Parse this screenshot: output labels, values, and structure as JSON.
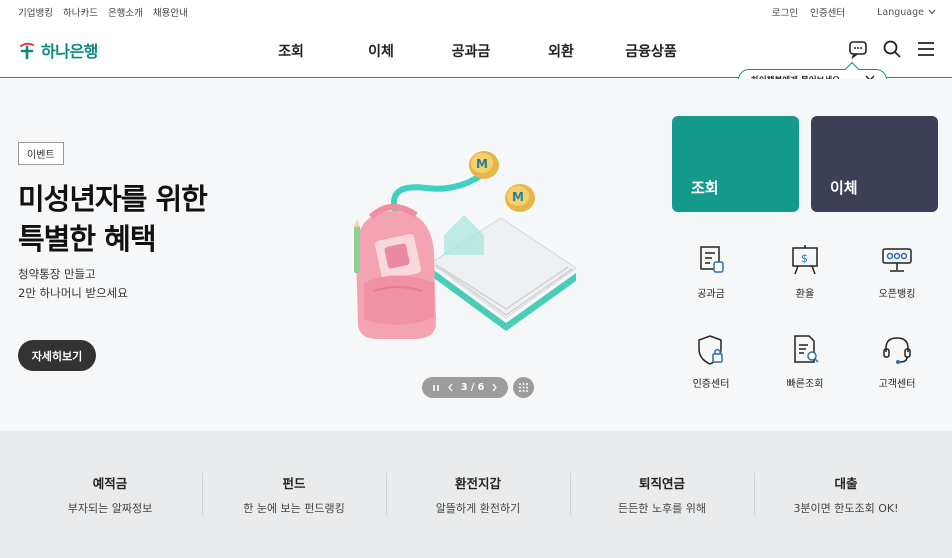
{
  "util": {
    "left": [
      "기업뱅킹",
      "하나카드",
      "은행소개",
      "채용안내"
    ],
    "login": "로그인",
    "cert_center": "인증센터",
    "language": "Language"
  },
  "header": {
    "logo": "하나은행",
    "nav": [
      "조회",
      "이체",
      "공과금",
      "외환",
      "금융상품"
    ]
  },
  "chat_tip": "하이챗봇에게 물어보세요~",
  "hero": {
    "badge": "이벤트",
    "title_line1": "미성년자를 위한",
    "title_line2": "특별한 혜택",
    "sub_line1": "청약통장 만들고",
    "sub_line2": "2만 하나머니 받으세요",
    "detail_button": "자세히보기",
    "pager": "3 / 6"
  },
  "quick": {
    "tile_lookup": "조회",
    "tile_transfer": "이체",
    "items": [
      "공과금",
      "환율",
      "오픈뱅킹",
      "인증센터",
      "빠른조회",
      "고객센터"
    ]
  },
  "bottom": [
    {
      "title": "예적금",
      "sub": "부자되는 알짜정보"
    },
    {
      "title": "펀드",
      "sub": "한 눈에 보는 펀드랭킹"
    },
    {
      "title": "환전지갑",
      "sub": "알뜰하게 환전하기"
    },
    {
      "title": "퇴직연금",
      "sub": "든든한 노후를 위해"
    },
    {
      "title": "대출",
      "sub": "3분이면 한도조회 OK!"
    }
  ],
  "colors": {
    "brand": "#0b8a80",
    "tile_lookup": "#139a8d",
    "tile_transfer": "#3d3f54"
  },
  "icons": {
    "chatbot": "chatbot-icon",
    "search": "search-icon",
    "menu": "menu-icon"
  }
}
